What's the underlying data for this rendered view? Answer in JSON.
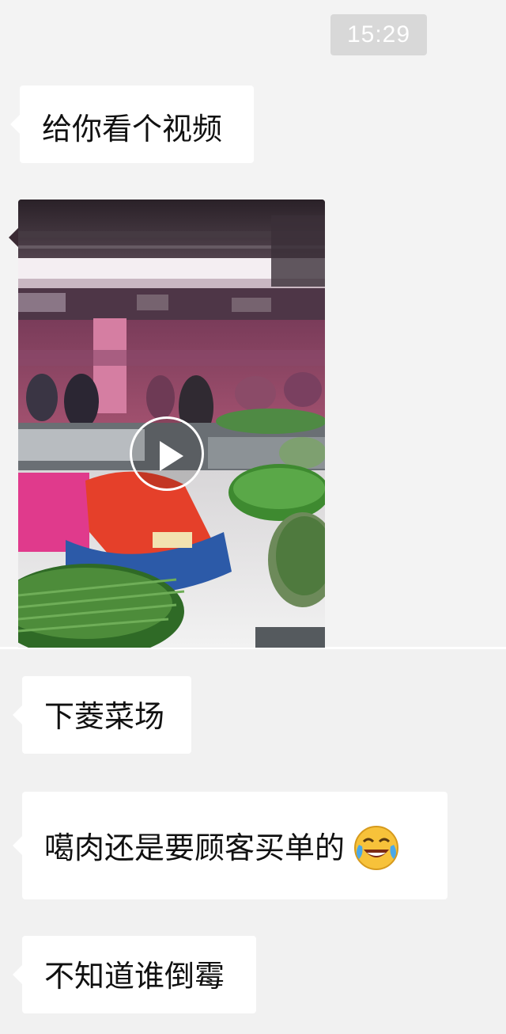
{
  "timestamp": "15:29",
  "messages": [
    {
      "type": "text",
      "text": "给你看个视频"
    },
    {
      "type": "video",
      "thumbnail": "market-video-thumbnail",
      "control": "play-icon"
    },
    {
      "type": "text",
      "text": "下菱菜场"
    },
    {
      "type": "text",
      "text": "噶肉还是要顾客买单的",
      "emoji": "laughing-crying-emoji"
    },
    {
      "type": "text",
      "text": "不知道谁倒霉"
    }
  ],
  "colors": {
    "chat_background": "#f3f3f3",
    "bubble": "#ffffff",
    "timestamp_badge": "#d8d8d8",
    "text": "#111111"
  }
}
